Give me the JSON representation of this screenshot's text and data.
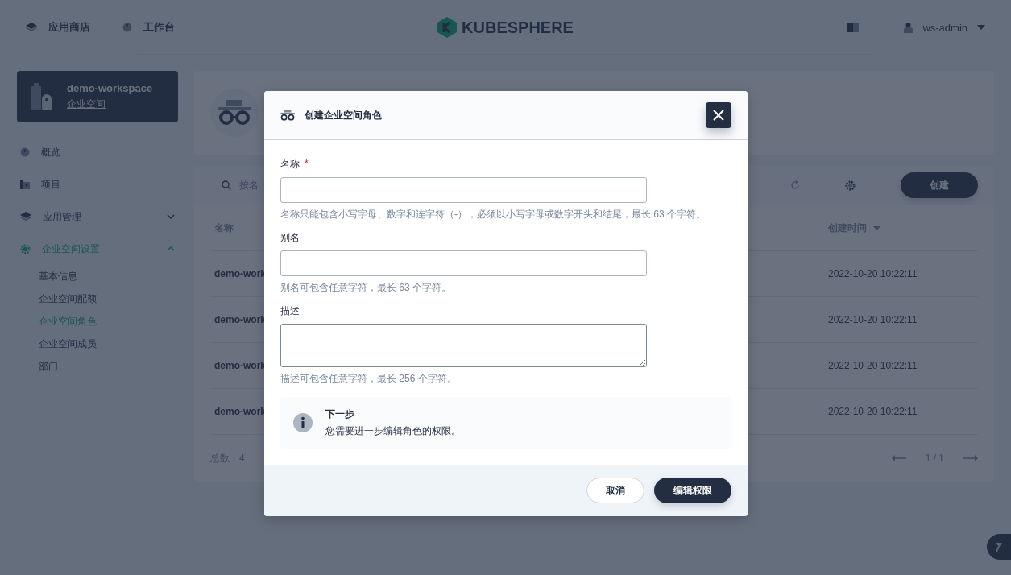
{
  "header": {
    "nav": [
      {
        "label": "应用商店"
      },
      {
        "label": "工作台"
      }
    ],
    "logo": "KUBESPHERE",
    "user": "ws-admin"
  },
  "workspace": {
    "name": "demo-workspace",
    "type": "企业空间"
  },
  "sidebar": {
    "items": [
      {
        "label": "概览",
        "selected": false
      },
      {
        "label": "项目",
        "selected": false
      },
      {
        "label": "应用管理",
        "selected": false,
        "expanded": false
      },
      {
        "label": "企业空间设置",
        "selected": true,
        "expanded": true,
        "children": [
          {
            "label": "基本信息",
            "selected": false
          },
          {
            "label": "企业空间配额",
            "selected": false
          },
          {
            "label": "企业空间角色",
            "selected": true
          },
          {
            "label": "企业空间成员",
            "selected": false
          },
          {
            "label": "部门",
            "selected": false
          }
        ]
      }
    ]
  },
  "toolbar": {
    "search": {
      "placeholder": "按名"
    },
    "create_button": "创建"
  },
  "table": {
    "columns": [
      "名称",
      "创建时间"
    ],
    "rows": [
      {
        "name": "demo-work",
        "created": "2022-10-20 10:22:11"
      },
      {
        "name": "demo-work",
        "created": "2022-10-20 10:22:11"
      },
      {
        "name": "demo-work",
        "created": "2022-10-20 10:22:11"
      },
      {
        "name": "demo-work",
        "created": "2022-10-20 10:22:11"
      }
    ],
    "total": "总数：4",
    "page": "1 / 1"
  },
  "dialog": {
    "title": "创建企业空间角色",
    "fields": [
      {
        "kind": "input",
        "label": "名称",
        "required_mark": "*",
        "hint": "名称只能包含小写字母、数字和连字符（-），必须以小写字母或数字开头和结尾，最长 63 个字符。"
      },
      {
        "kind": "input",
        "label": "别名",
        "hint": "别名可包含任意字符，最长 63 个字符。"
      },
      {
        "kind": "textarea",
        "label": "描述",
        "hint": "描述可包含任意字符，最长 256 个字符。"
      }
    ],
    "notice": {
      "title": "下一步",
      "text": "您需要进一步编辑角色的权限。"
    },
    "buttons": {
      "cancel": "取消",
      "confirm": "编辑权限"
    }
  }
}
